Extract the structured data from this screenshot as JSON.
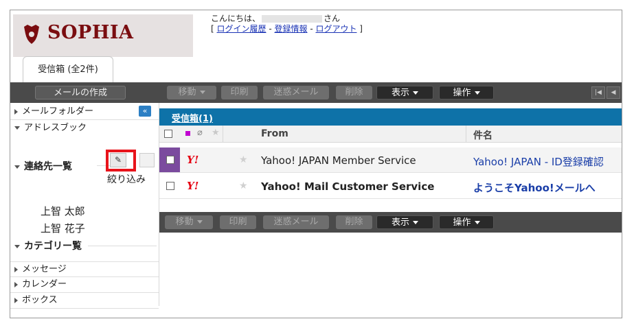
{
  "header": {
    "logo_text": "SOPHIA",
    "greeting_prefix": "こんにちは、",
    "greeting_suffix": "さん",
    "links_open": "[ ",
    "link_login_history": "ログイン履歴",
    "sep1": " - ",
    "link_account_info": "登録情報",
    "sep2": " - ",
    "link_logout": "ログアウト",
    "links_close": " ]"
  },
  "tab": {
    "label": "受信箱 (全2件)"
  },
  "toolbar": {
    "compose": "メールの作成",
    "move": "移動",
    "print": "印刷",
    "spam": "迷惑メール",
    "delete": "削除",
    "view": "表示",
    "actions": "操作"
  },
  "sidebar": {
    "collapse_icon": "«",
    "mail_folders": "メールフォルダー",
    "address_book": "アドレスブック",
    "contacts_title": "連絡先一覧",
    "filter_label": "絞り込み",
    "contacts": [
      "上智 太郎",
      "上智 花子"
    ],
    "categories_title": "カテゴリー覧",
    "messages": "メッセージ",
    "calendar": "カレンダー",
    "boxes": "ボックス"
  },
  "mail_list": {
    "folder_link": "受信箱(1)",
    "col_from": "From",
    "col_subject": "件名",
    "rows": [
      {
        "from": "Yahoo! JAPAN Member Service",
        "subject": "Yahoo! JAPAN - ID登録確認",
        "unread": false
      },
      {
        "from": "Yahoo! Mail Customer Service",
        "subject": "ようこそYahoo!メールへ",
        "unread": true
      }
    ],
    "logo_text": "Y!"
  },
  "colors": {
    "brand": "#7a0d10",
    "accent_blue": "#0e72a8",
    "highlight_red": "#e8141b",
    "selected_purple": "#7b4b9e"
  }
}
